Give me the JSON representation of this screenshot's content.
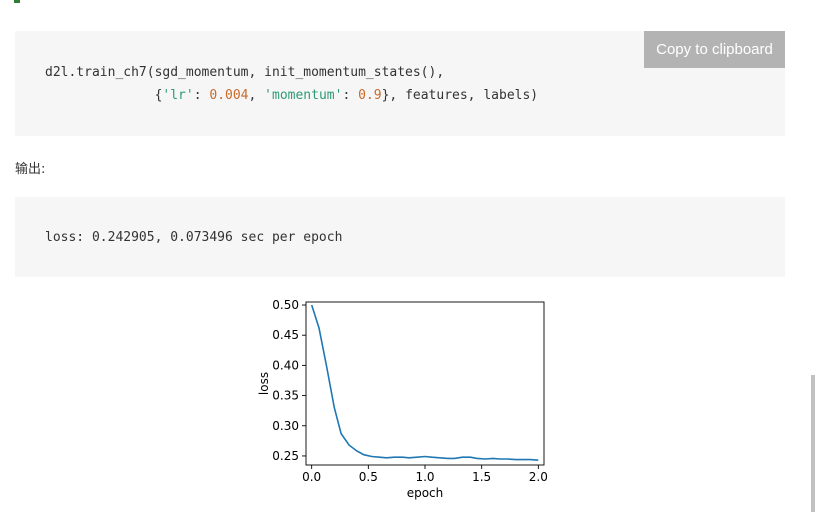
{
  "input_code": {
    "line1": "d2l.train_ch7(sgd_momentum, init_momentum_states(),",
    "line2_indent": "              {",
    "line2_tokens": [
      "'lr'",
      ": ",
      "0.004",
      ", ",
      "'momentum'",
      ": ",
      "0.9",
      "}, features, labels)"
    ]
  },
  "copy_button_label": "Copy to clipboard",
  "output_label": "输出:",
  "output_text": "loss: 0.242905, 0.073496 sec per epoch",
  "colors": {
    "string": "#2e9a73",
    "number": "#c86a2a",
    "line": "#1f77b4",
    "copy_button_bg": "#b3b3b3"
  },
  "chart_data": {
    "type": "line",
    "xlabel": "epoch",
    "ylabel": "loss",
    "xlim": [
      -0.05,
      2.05
    ],
    "ylim": [
      0.235,
      0.505
    ],
    "xticks": [
      0.0,
      0.5,
      1.0,
      1.5,
      2.0
    ],
    "xtick_labels": [
      "0.0",
      "0.5",
      "1.0",
      "1.5",
      "2.0"
    ],
    "yticks": [
      0.25,
      0.3,
      0.35,
      0.4,
      0.45,
      0.5
    ],
    "ytick_labels": [
      "0.25",
      "0.30",
      "0.35",
      "0.40",
      "0.45",
      "0.50"
    ],
    "grid": false,
    "series": [
      {
        "x": [
          0.0,
          0.065,
          0.13,
          0.2,
          0.26,
          0.33,
          0.4,
          0.46,
          0.53,
          0.6,
          0.66,
          0.73,
          0.8,
          0.86,
          0.93,
          1.0,
          1.06,
          1.13,
          1.2,
          1.26,
          1.33,
          1.4,
          1.46,
          1.53,
          1.6,
          1.66,
          1.73,
          1.8,
          1.86,
          1.93,
          2.0
        ],
        "y": [
          0.5,
          0.462,
          0.4,
          0.33,
          0.287,
          0.268,
          0.258,
          0.252,
          0.249,
          0.248,
          0.247,
          0.248,
          0.248,
          0.247,
          0.248,
          0.249,
          0.248,
          0.247,
          0.246,
          0.246,
          0.248,
          0.248,
          0.246,
          0.245,
          0.246,
          0.245,
          0.245,
          0.244,
          0.244,
          0.244,
          0.243
        ]
      }
    ]
  }
}
